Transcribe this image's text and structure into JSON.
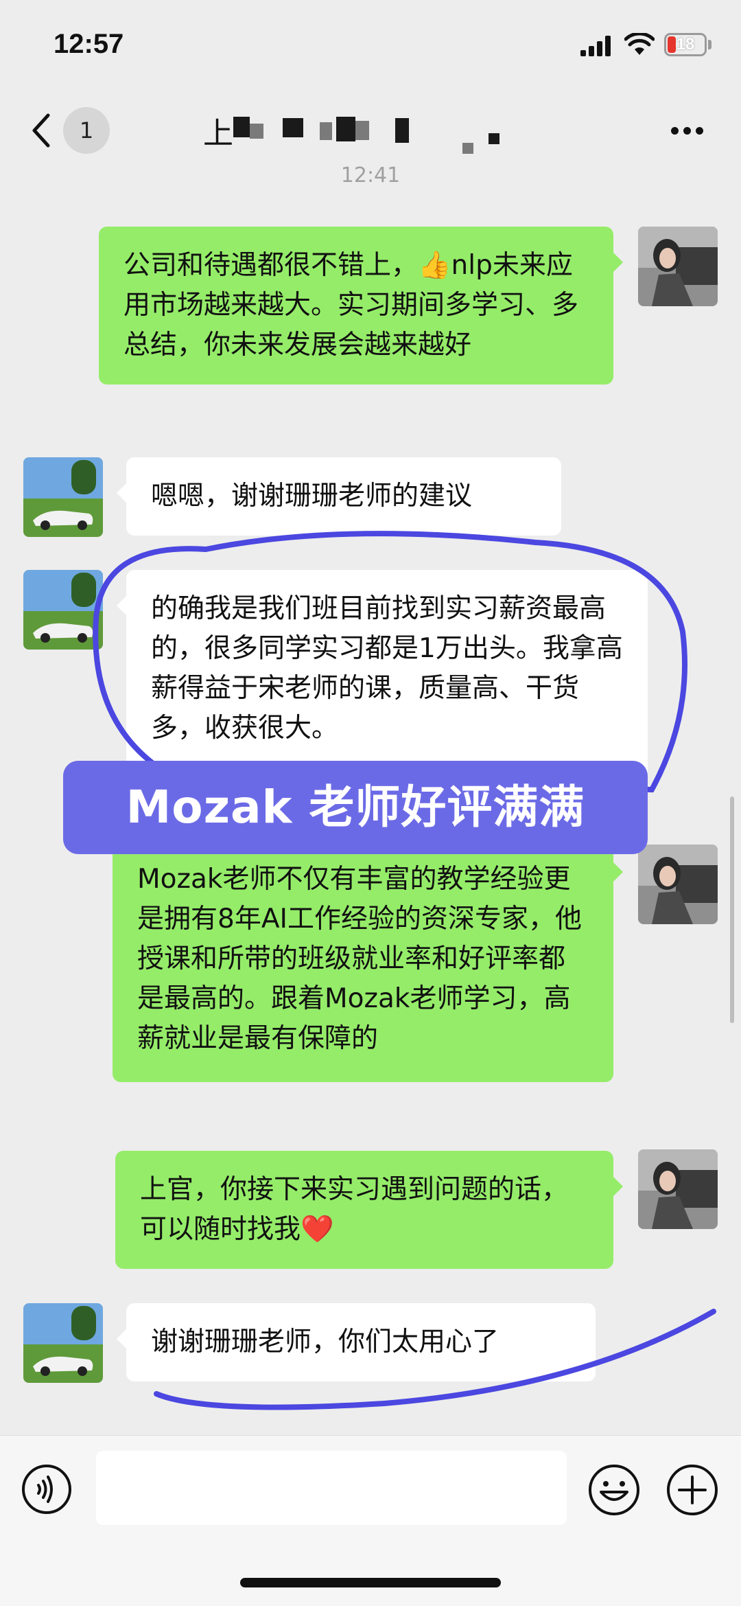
{
  "status": {
    "time": "12:57",
    "battery": "18"
  },
  "nav": {
    "unread_count": "1",
    "title_visible": "上"
  },
  "timestamp": "12:41",
  "messages": [
    {
      "side": "right",
      "text": "公司和待遇都很不错上，👍nlp未来应用市场越来越大。实习期间多学习、多总结，你未来发展会越来越好"
    },
    {
      "side": "left",
      "text": "嗯嗯，谢谢珊珊老师的建议"
    },
    {
      "side": "left",
      "text": "的确我是我们班目前找到实习薪资最高的，很多同学实习都是1万出头。我拿高薪得益于宋老师的课，质量高、干货多，收获很大。"
    },
    {
      "side": "right",
      "text": "Mozak老师不仅有丰富的教学经验更是拥有8年AI工作经验的资深专家，他授课和所带的班级就业率和好评率都是最高的。跟着Mozak老师学习，高薪就业是最有保障的"
    },
    {
      "side": "right",
      "text": "上官，你接下来实习遇到问题的话，可以随时找我❤️"
    },
    {
      "side": "left",
      "text": "谢谢珊珊老师，你们太用心了"
    }
  ],
  "overlay": {
    "banner": "Mozak 老师好评满满"
  },
  "colors": {
    "green_bubble": "#95ec69",
    "banner": "#6b6ae6",
    "ink": "#4b47e0",
    "background": "#ededed"
  }
}
